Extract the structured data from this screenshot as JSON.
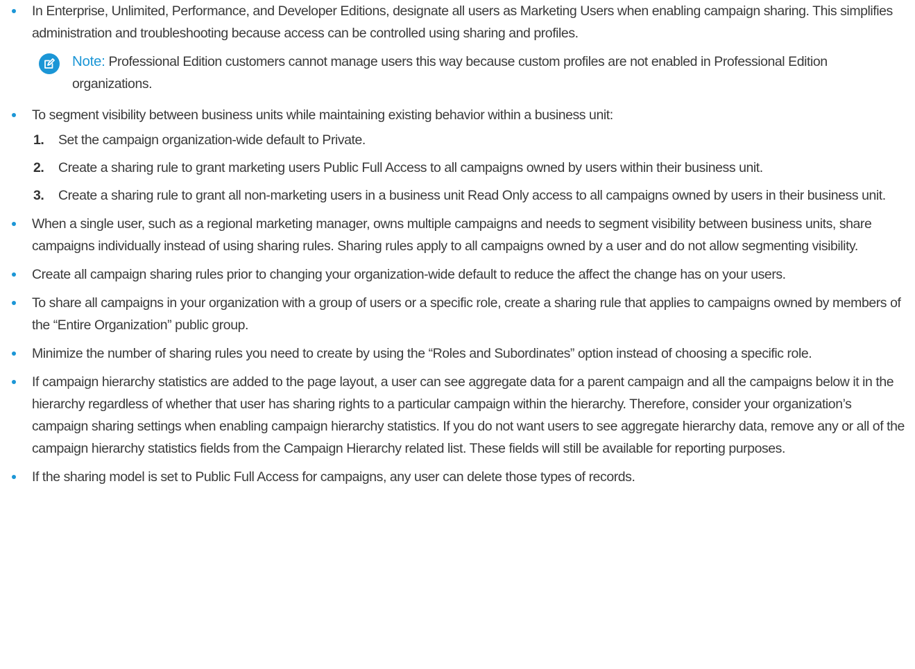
{
  "content": {
    "bullets": [
      {
        "text": "In Enterprise, Unlimited, Performance, and Developer Editions, designate all users as Marketing Users when enabling campaign sharing. This simplifies administration and troubleshooting because access can be controlled using sharing and profiles.",
        "note": {
          "label": "Note:",
          "text": "Professional Edition customers cannot manage users this way because custom profiles are not enabled in Professional Edition organizations.",
          "icon": "edit-note-icon"
        }
      },
      {
        "text": "To segment visibility between business units while maintaining existing behavior within a business unit:",
        "steps": [
          {
            "num": "1.",
            "text": "Set the campaign organization-wide default to Private."
          },
          {
            "num": "2.",
            "text": "Create a sharing rule to grant marketing users Public Full Access to all campaigns owned by users within their business unit."
          },
          {
            "num": "3.",
            "text": "Create a sharing rule to grant all non-marketing users in a business unit Read Only access to all campaigns owned by users in their business unit."
          }
        ]
      },
      {
        "text": "When a single user, such as a regional marketing manager, owns multiple campaigns and needs to segment visibility between business units, share campaigns individually instead of using sharing rules. Sharing rules apply to all campaigns owned by a user and do not allow segmenting visibility."
      },
      {
        "text": "Create all campaign sharing rules prior to changing your organization-wide default to reduce the affect the change has on your users."
      },
      {
        "text": "To share all campaigns in your organization with a group of users or a specific role, create a sharing rule that applies to campaigns owned by members of the “Entire Organization” public group."
      },
      {
        "text": "Minimize the number of sharing rules you need to create by using the “Roles and Subordinates” option instead of choosing a specific role."
      },
      {
        "text": "If campaign hierarchy statistics are added to the page layout, a user can see aggregate data for a parent campaign and all the campaigns below it in the hierarchy regardless of whether that user has sharing rights to a particular campaign within the hierarchy. Therefore, consider your organization’s campaign sharing settings when enabling campaign hierarchy statistics. If you do not want users to see aggregate hierarchy data, remove any or all of the campaign hierarchy statistics fields from the Campaign Hierarchy related list. These fields will still be available for reporting purposes."
      },
      {
        "text": "If the sharing model is set to Public Full Access for campaigns, any user can delete those types of records."
      }
    ]
  },
  "colors": {
    "accent": "#1b96d6",
    "text": "#3a3a3a"
  }
}
